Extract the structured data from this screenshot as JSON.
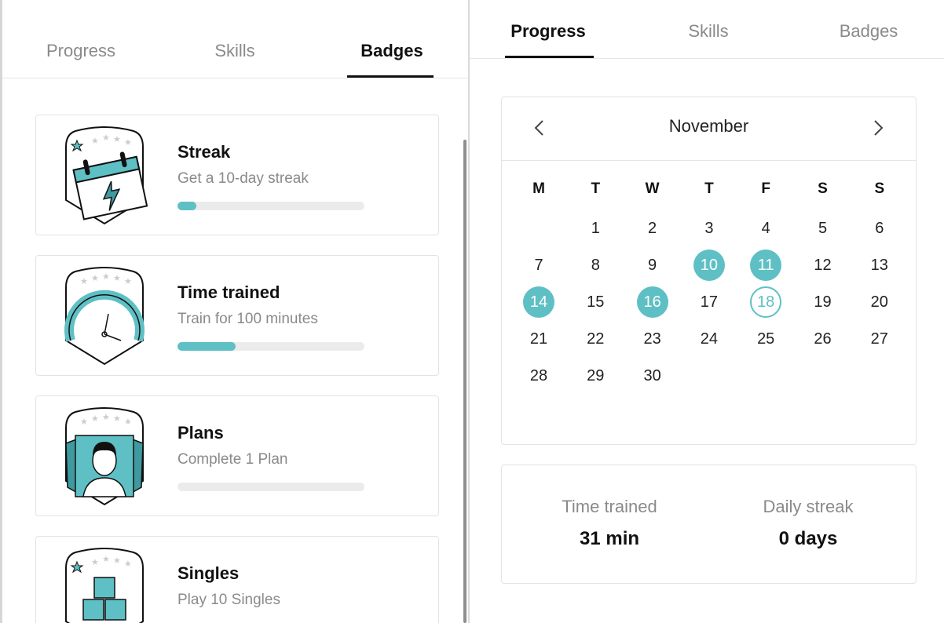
{
  "left_panel": {
    "tabs": [
      {
        "label": "Progress",
        "active": false
      },
      {
        "label": "Skills",
        "active": false
      },
      {
        "label": "Badges",
        "active": true
      }
    ],
    "badges": [
      {
        "title": "Streak",
        "description": "Get a 10-day streak",
        "progress": 0.1,
        "icon": "streak-calendar-badge-icon"
      },
      {
        "title": "Time trained",
        "description": "Train for 100 minutes",
        "progress": 0.31,
        "icon": "stopwatch-badge-icon"
      },
      {
        "title": "Plans",
        "description": "Complete 1 Plan",
        "progress": 0.0,
        "icon": "plan-book-badge-icon"
      },
      {
        "title": "Singles",
        "description": "Play 10 Singles",
        "progress": 0.0,
        "icon": "singles-blocks-badge-icon"
      }
    ]
  },
  "right_panel": {
    "tabs": [
      {
        "label": "Progress",
        "active": true
      },
      {
        "label": "Skills",
        "active": false
      },
      {
        "label": "Badges",
        "active": false
      }
    ],
    "calendar": {
      "month": "November",
      "weekdays": [
        "M",
        "T",
        "W",
        "T",
        "F",
        "S",
        "S"
      ],
      "rows": [
        [
          "",
          "1",
          "2",
          "3",
          "4",
          "5",
          "6"
        ],
        [
          "7",
          "8",
          "9",
          "10",
          "11",
          "12",
          "13"
        ],
        [
          "14",
          "15",
          "16",
          "17",
          "18",
          "19",
          "20"
        ],
        [
          "21",
          "22",
          "23",
          "24",
          "25",
          "26",
          "27"
        ],
        [
          "28",
          "29",
          "30",
          "",
          "",
          "",
          ""
        ]
      ],
      "trained_days": [
        "10",
        "11",
        "14",
        "16"
      ],
      "today": "18"
    },
    "stats": {
      "time_trained_label": "Time trained",
      "time_trained_value": "31 min",
      "daily_streak_label": "Daily streak",
      "daily_streak_value": "0 days"
    }
  },
  "colors": {
    "accent": "#5ec0c4",
    "accent_dark": "#3f9aa0",
    "muted_text": "#8a8a8a",
    "track": "#ebebeb"
  }
}
